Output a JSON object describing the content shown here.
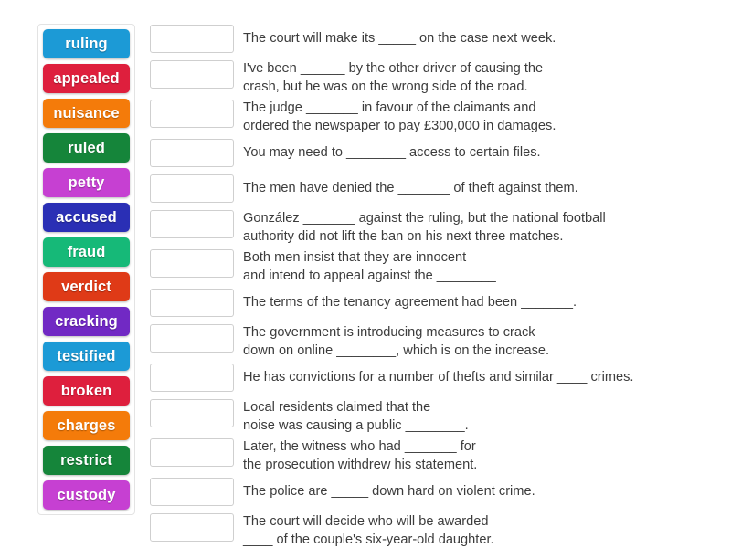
{
  "activity": {
    "type": "match-the-word-gap-fill",
    "word_bank": [
      {
        "label": "ruling",
        "color": "#1c9ad6"
      },
      {
        "label": "appealed",
        "color": "#de1f3d"
      },
      {
        "label": "nuisance",
        "color": "#f47b0a"
      },
      {
        "label": "ruled",
        "color": "#15853a"
      },
      {
        "label": "petty",
        "color": "#c640d2"
      },
      {
        "label": "accused",
        "color": "#2a2fb5"
      },
      {
        "label": "fraud",
        "color": "#16b978"
      },
      {
        "label": "verdict",
        "color": "#df3a17"
      },
      {
        "label": "cracking",
        "color": "#7129c4"
      },
      {
        "label": "testified",
        "color": "#1c9ad6"
      },
      {
        "label": "broken",
        "color": "#de1f3d"
      },
      {
        "label": "charges",
        "color": "#f47b0a"
      },
      {
        "label": "restrict",
        "color": "#15853a"
      },
      {
        "label": "custody",
        "color": "#c640d2"
      }
    ],
    "rows": [
      {
        "answer_placeholder": "",
        "lines": 1,
        "text": "The court will make its _____ on the case next week."
      },
      {
        "answer_placeholder": "",
        "lines": 2,
        "text": "I've been ______ by the other driver of causing the\ncrash, but he was on the wrong side of the road."
      },
      {
        "answer_placeholder": "",
        "lines": 2,
        "text": "The judge _______ in favour of the claimants and\nordered the newspaper to pay £300,000 in damages."
      },
      {
        "answer_placeholder": "",
        "lines": 1,
        "text": "You may need to ________ access to certain files."
      },
      {
        "answer_placeholder": "",
        "lines": 1,
        "text": "The men have denied the _______ of theft against them."
      },
      {
        "answer_placeholder": "",
        "lines": 2,
        "text": "González _______ against the ruling, but the national football\nauthority did not lift the ban on his next three matches."
      },
      {
        "answer_placeholder": "",
        "lines": 2,
        "text": "Both men insist that they are innocent\nand intend to appeal against the ________"
      },
      {
        "answer_placeholder": "",
        "lines": 1,
        "text": "The terms of the tenancy agreement had been _______."
      },
      {
        "answer_placeholder": "",
        "lines": 2,
        "text": "The government is introducing measures to crack\ndown on online ________, which is on the increase."
      },
      {
        "answer_placeholder": "",
        "lines": 1,
        "text": "He has convictions for a number of thefts and similar ____ crimes."
      },
      {
        "answer_placeholder": "",
        "lines": 2,
        "text": "Local residents claimed that the\nnoise was causing a public ________."
      },
      {
        "answer_placeholder": "",
        "lines": 2,
        "text": "Later, the witness who had _______ for\nthe prosecution withdrew his statement."
      },
      {
        "answer_placeholder": "",
        "lines": 1,
        "text": "The police are _____ down hard on violent crime."
      },
      {
        "answer_placeholder": "",
        "lines": 2,
        "text": "The court will decide who will be awarded\n____ of the couple's six-year-old daughter."
      }
    ]
  }
}
